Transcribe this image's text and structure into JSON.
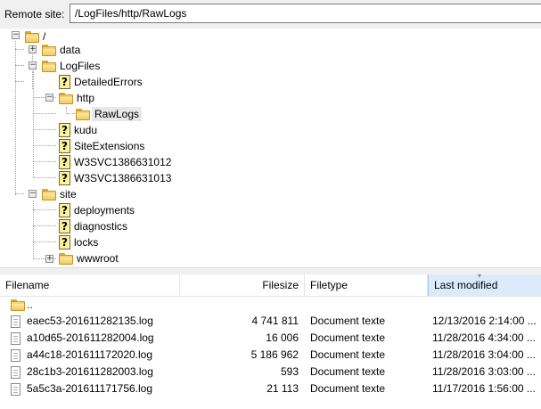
{
  "pathbar": {
    "label": "Remote site:",
    "value": "/LogFiles/http/RawLogs"
  },
  "tree": {
    "root": "/",
    "data": "data",
    "logfiles": "LogFiles",
    "detailederrors": "DetailedErrors",
    "http": "http",
    "rawlogs": "RawLogs",
    "kudu": "kudu",
    "siteextensions": "SiteExtensions",
    "w3svc1": "W3SVC1386631012",
    "w3svc2": "W3SVC1386631013",
    "site": "site",
    "deployments": "deployments",
    "diagnostics": "diagnostics",
    "locks": "locks",
    "wwwroot": "wwwroot"
  },
  "list": {
    "headers": {
      "filename": "Filename",
      "filesize": "Filesize",
      "filetype": "Filetype",
      "modified": "Last modified"
    },
    "parent": "..",
    "rows": [
      {
        "name": "eaec53-201611282135.log",
        "size": "4 741 811",
        "type": "Document texte",
        "modified": "12/13/2016 2:14:00 ..."
      },
      {
        "name": "a10d65-201611282004.log",
        "size": "16 006",
        "type": "Document texte",
        "modified": "11/28/2016 4:34:00 ..."
      },
      {
        "name": "a44c18-201611172020.log",
        "size": "5 186 962",
        "type": "Document texte",
        "modified": "11/28/2016 3:04:00 ..."
      },
      {
        "name": "28c1b3-201611282003.log",
        "size": "593",
        "type": "Document texte",
        "modified": "11/28/2016 3:03:00 ..."
      },
      {
        "name": "5a5c3a-201611171756.log",
        "size": "21 113",
        "type": "Document texte",
        "modified": "11/17/2016 1:56:00 ..."
      }
    ]
  }
}
